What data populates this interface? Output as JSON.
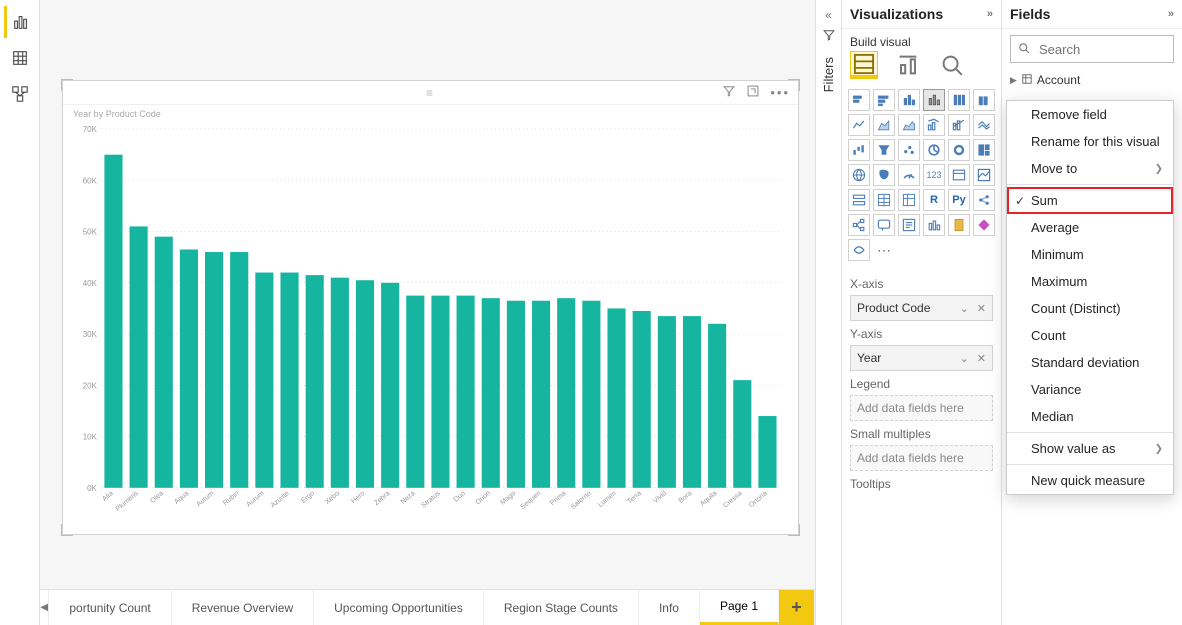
{
  "panes": {
    "visualizations_title": "Visualizations",
    "build_visual_label": "Build visual",
    "fields_title": "Fields",
    "filters_label": "Filters"
  },
  "search": {
    "placeholder": "Search"
  },
  "field_tree": {
    "root_table": "Account"
  },
  "viz": {
    "title": "Year by Product Code"
  },
  "wells": {
    "x_axis_label": "X-axis",
    "x_axis_value": "Product Code",
    "y_axis_label": "Y-axis",
    "y_axis_value": "Year",
    "legend_label": "Legend",
    "legend_placeholder": "Add data fields here",
    "small_multiples_label": "Small multiples",
    "small_multiples_placeholder": "Add data fields here",
    "tooltips_label": "Tooltips"
  },
  "tabs": {
    "items": [
      "portunity Count",
      "Revenue Overview",
      "Upcoming Opportunities",
      "Region Stage Counts",
      "Info",
      "Page 1"
    ],
    "active_index": 5
  },
  "context_menu": {
    "remove_field": "Remove field",
    "rename": "Rename for this visual",
    "move_to": "Move to",
    "sum": "Sum",
    "average": "Average",
    "minimum": "Minimum",
    "maximum": "Maximum",
    "count_distinct": "Count (Distinct)",
    "count": "Count",
    "std_dev": "Standard deviation",
    "variance": "Variance",
    "median": "Median",
    "show_value_as": "Show value as",
    "new_quick_measure": "New quick measure"
  },
  "chart_data": {
    "type": "bar",
    "title": "Year by Product Code",
    "xlabel": "",
    "ylabel": "",
    "ylim": [
      0,
      70000
    ],
    "y_ticks": [
      "0K",
      "10K",
      "20K",
      "30K",
      "40K",
      "50K",
      "60K",
      "70K"
    ],
    "categories": [
      "Alia",
      "Plumeris",
      "Olea",
      "Aqua",
      "Autum",
      "Rubin",
      "Aurum",
      "Azurite",
      "Ergo",
      "Xebo",
      "Hero",
      "Zebra",
      "Neza",
      "Stratus",
      "Duo",
      "Orion",
      "Mago",
      "Sequen",
      "Prima",
      "Salerno",
      "Lumen",
      "Terra",
      "Vivid",
      "Bora",
      "Aquila",
      "Cressa",
      "Ortona"
    ],
    "values": [
      65000,
      51000,
      49000,
      46500,
      46000,
      46000,
      42000,
      42000,
      41500,
      41000,
      40500,
      40000,
      37500,
      37500,
      37500,
      37000,
      36500,
      36500,
      37000,
      36500,
      35000,
      34500,
      33500,
      33500,
      32000,
      21000,
      14000
    ],
    "bar_color": "#16b5a0"
  }
}
